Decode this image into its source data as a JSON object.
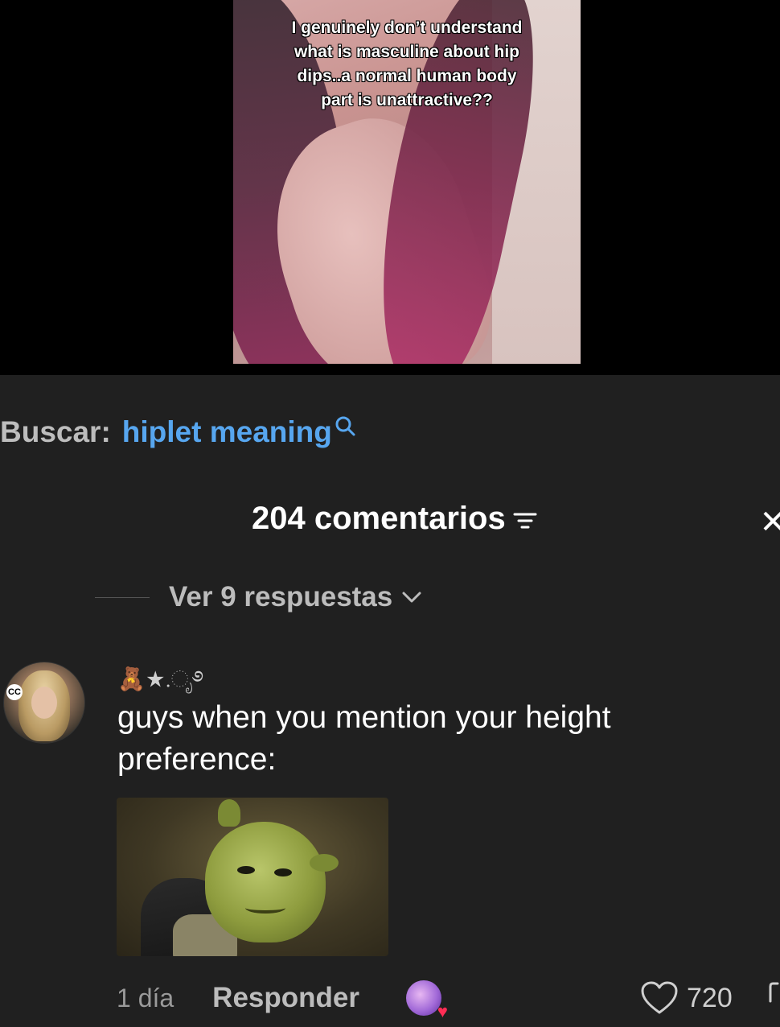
{
  "video": {
    "overlay_text": "I genuinely don’t understand what is masculine about hip dips..a normal human body part is unattractive??"
  },
  "search": {
    "label": "Buscar:",
    "term": "hiplet meaning"
  },
  "comments_header": {
    "count_text": "204 comentarios"
  },
  "thread": {
    "view_replies": "Ver 9 respuestas"
  },
  "comment": {
    "username": "🧸★.ೃ࿔",
    "avatar_badge": "CC",
    "text": "guys when you mention your height preference:",
    "time": "1 día",
    "reply_label": "Responder",
    "likes": "720"
  },
  "icons": {
    "search": "search-icon",
    "filter": "filter-icon",
    "close": "close-icon",
    "chevron": "chevron-down-icon",
    "like": "heart-icon",
    "dislike": "dislike-icon"
  },
  "colors": {
    "panel_bg": "#202020",
    "link_blue": "#57a6ef",
    "secondary_text": "#bcbcbc"
  }
}
